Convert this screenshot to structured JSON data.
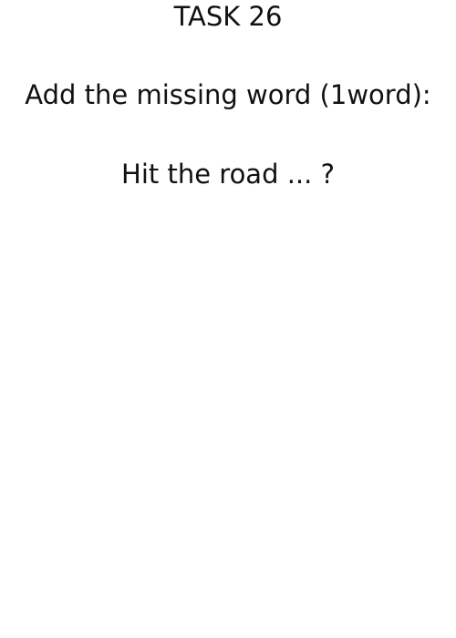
{
  "task": {
    "title": "TASK 26",
    "instruction": "Add the missing word (1word):",
    "question": "Hit the road ... ?"
  }
}
